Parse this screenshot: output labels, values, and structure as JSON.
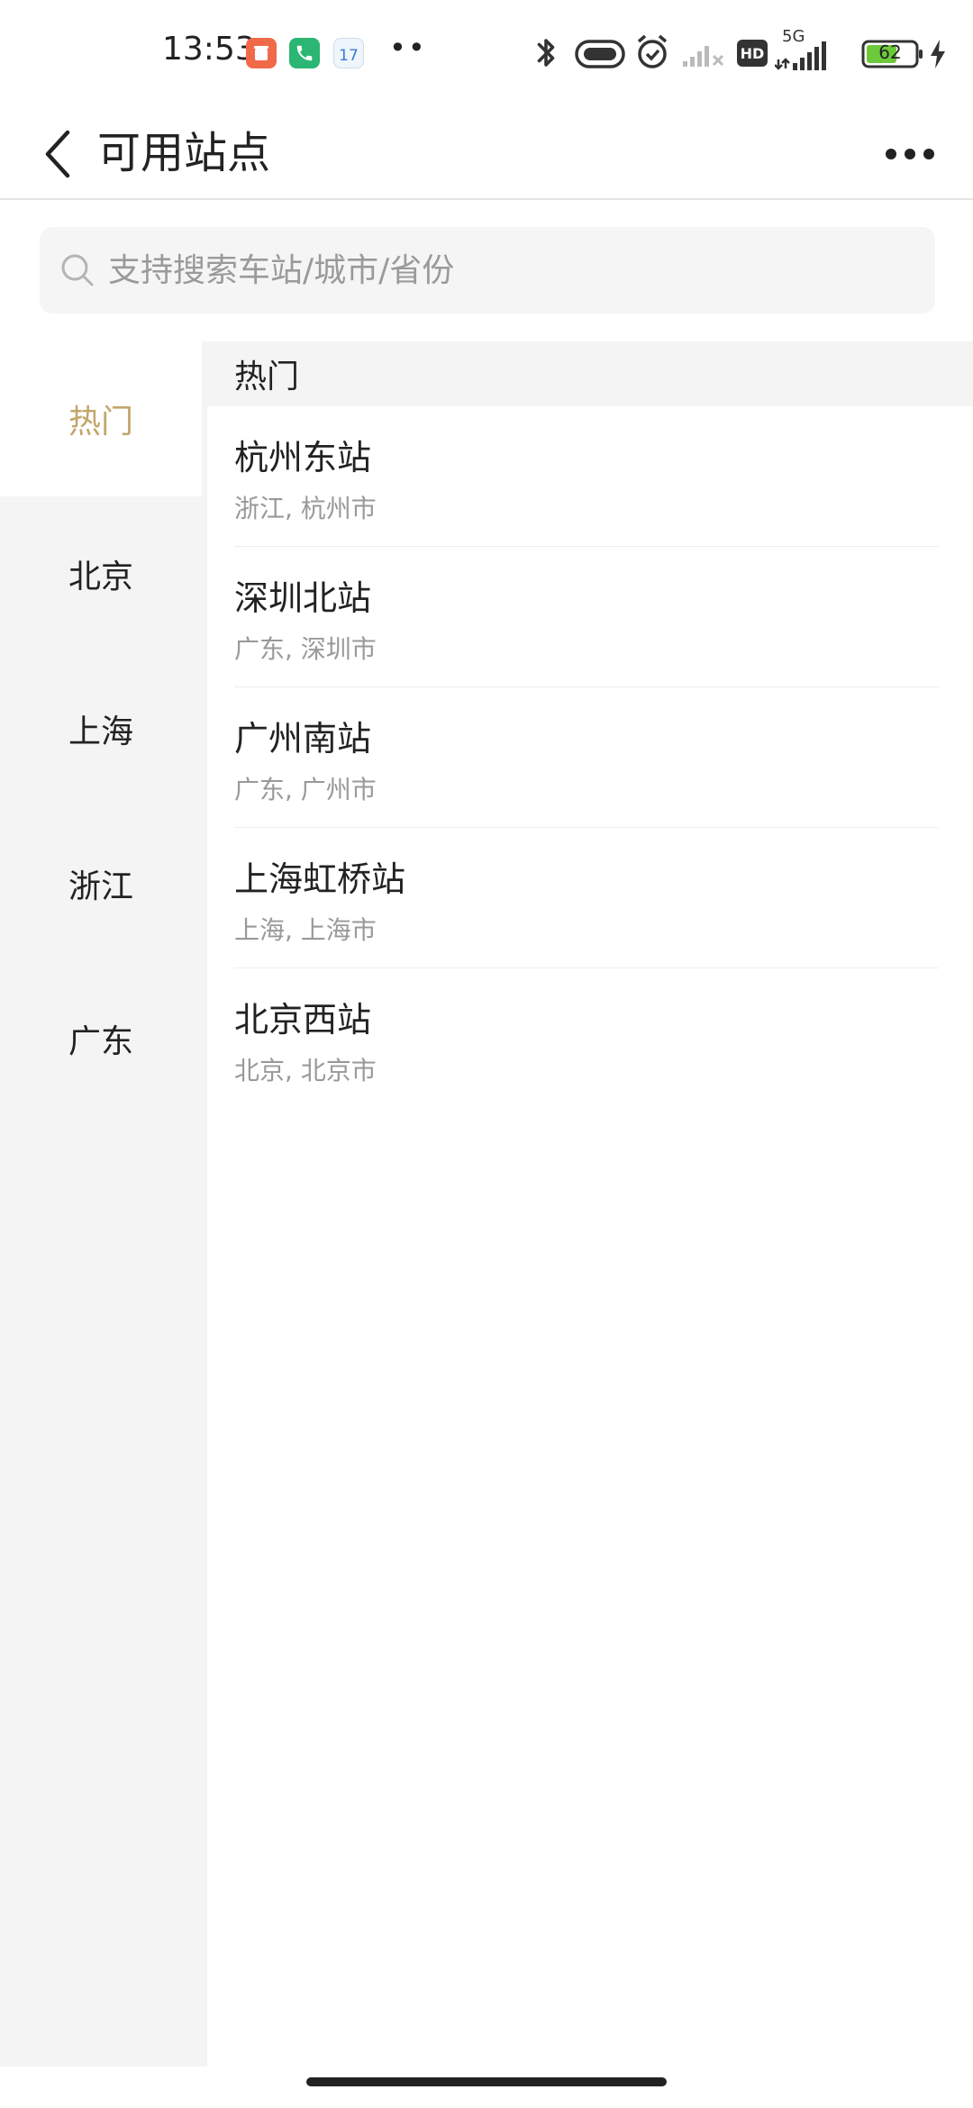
{
  "status_bar": {
    "time": "13:53",
    "calendar_day": "17",
    "battery_level": "62",
    "network_label": "5G",
    "hd_label": "HD",
    "more_dots": "••",
    "icons": [
      "notification-app-icon",
      "phone-icon",
      "calendar-icon",
      "bluetooth-icon",
      "nfc-icon",
      "alarm-icon",
      "signal-1-icon",
      "hd-icon",
      "signal-5g-icon",
      "battery-icon",
      "charging-icon"
    ],
    "colors": {
      "notification_app": "#f06a4a",
      "phone": "#2bb673",
      "battery_fill": "#6cc93a"
    }
  },
  "header": {
    "title": "可用站点",
    "back_icon": "chevron-left-icon",
    "more_icon": "more-horizontal-icon"
  },
  "search": {
    "placeholder": "支持搜索车站/城市/省份",
    "value": "",
    "icon": "search-icon"
  },
  "sidebar": {
    "items": [
      {
        "label": "热门",
        "active": true
      },
      {
        "label": "北京",
        "active": false
      },
      {
        "label": "上海",
        "active": false
      },
      {
        "label": "浙江",
        "active": false
      },
      {
        "label": "广东",
        "active": false
      }
    ],
    "active_color": "#c2a76a"
  },
  "content": {
    "section_title": "热门",
    "stations": [
      {
        "name": "杭州东站",
        "location": "浙江, 杭州市"
      },
      {
        "name": "深圳北站",
        "location": "广东, 深圳市"
      },
      {
        "name": "广州南站",
        "location": "广东, 广州市"
      },
      {
        "name": "上海虹桥站",
        "location": "上海, 上海市"
      },
      {
        "name": "北京西站",
        "location": "北京, 北京市"
      }
    ]
  }
}
